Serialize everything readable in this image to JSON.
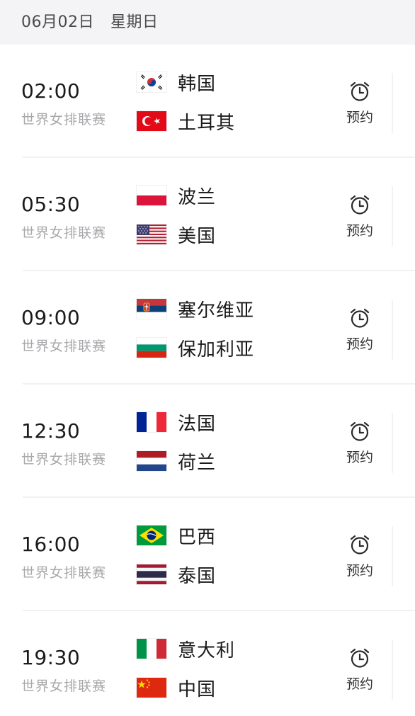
{
  "header": {
    "date": "06月02日",
    "weekday": "星期日"
  },
  "matches": [
    {
      "time": "02:00",
      "league": "世界女排联赛",
      "reserve_label": "预约",
      "home": {
        "name": "韩国",
        "flag": "korea-flag-icon"
      },
      "away": {
        "name": "土耳其",
        "flag": "turkey-flag-icon"
      }
    },
    {
      "time": "05:30",
      "league": "世界女排联赛",
      "reserve_label": "预约",
      "home": {
        "name": "波兰",
        "flag": "poland-flag-icon"
      },
      "away": {
        "name": "美国",
        "flag": "usa-flag-icon"
      }
    },
    {
      "time": "09:00",
      "league": "世界女排联赛",
      "reserve_label": "预约",
      "home": {
        "name": "塞尔维亚",
        "flag": "serbia-flag-icon"
      },
      "away": {
        "name": "保加利亚",
        "flag": "bulgaria-flag-icon"
      }
    },
    {
      "time": "12:30",
      "league": "世界女排联赛",
      "reserve_label": "预约",
      "home": {
        "name": "法国",
        "flag": "france-flag-icon"
      },
      "away": {
        "name": "荷兰",
        "flag": "netherlands-flag-icon"
      }
    },
    {
      "time": "16:00",
      "league": "世界女排联赛",
      "reserve_label": "预约",
      "home": {
        "name": "巴西",
        "flag": "brazil-flag-icon"
      },
      "away": {
        "name": "泰国",
        "flag": "thailand-flag-icon"
      }
    },
    {
      "time": "19:30",
      "league": "世界女排联赛",
      "reserve_label": "预约",
      "home": {
        "name": "意大利",
        "flag": "italy-flag-icon"
      },
      "away": {
        "name": "中国",
        "flag": "china-flag-icon"
      }
    }
  ],
  "colors": {
    "header_bg": "#f4f4f6",
    "league_text": "#a8a8ac",
    "divider": "#f1f1f3"
  }
}
